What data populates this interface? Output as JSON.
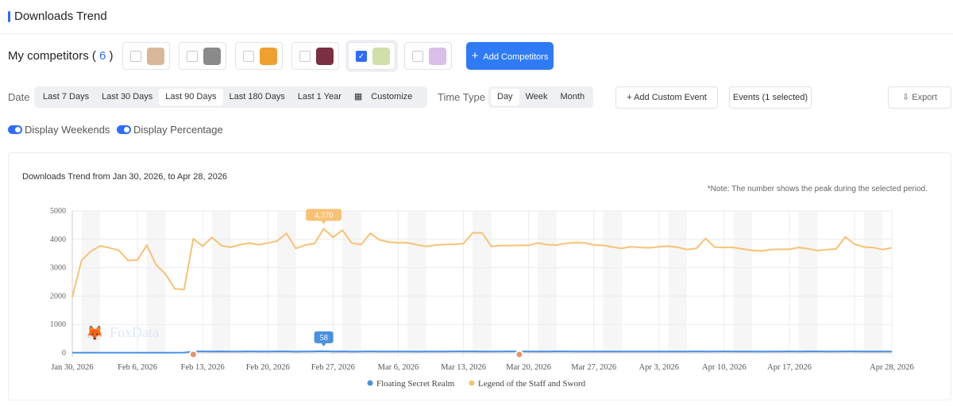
{
  "header": {
    "title": "Downloads Trend"
  },
  "competitors": {
    "label": "My competitors (",
    "count": "6",
    "close": ")",
    "items": [
      {
        "checked": false,
        "color": "#d9b89a"
      },
      {
        "checked": false,
        "color": "#8a8a8a"
      },
      {
        "checked": false,
        "color": "#f0a030"
      },
      {
        "checked": false,
        "color": "#7a3040"
      },
      {
        "checked": true,
        "color": "#cfe0a8"
      },
      {
        "checked": false,
        "color": "#d8c0e8"
      }
    ],
    "add_label": "Add Competitors"
  },
  "date": {
    "label": "Date",
    "options": [
      "Last 7 Days",
      "Last 30 Days",
      "Last 90 Days",
      "Last 180 Days",
      "Last 1 Year",
      "Customize"
    ],
    "selected": "Last 90 Days"
  },
  "time_type": {
    "label": "Time Type",
    "options": [
      "Day",
      "Week",
      "Month"
    ],
    "selected": "Day"
  },
  "buttons": {
    "add_event": "Add Custom Event",
    "events": "Events (1 selected)",
    "export": "Export"
  },
  "toggles": {
    "weekends": "Display Weekends",
    "percentage": "Display Percentage",
    "weekends_on": true,
    "percentage_on": true
  },
  "chart_title": "Downloads Trend from Jan 30, 2026, to Apr 28, 2026",
  "note": "*Note: The number shows the peak during the selected period.",
  "watermark": "FoxData",
  "chart_data": {
    "type": "line",
    "x_start": "2026-01-30",
    "x_end": "2026-04-28",
    "interval": "day",
    "ylim": [
      0,
      5000
    ],
    "yticks": [
      0,
      1000,
      2000,
      3000,
      4000,
      5000
    ],
    "xtick_labels": [
      "Jan 30, 2026",
      "Feb 6, 2026",
      "Feb 13, 2026",
      "Feb 20, 2026",
      "Feb 27, 2026",
      "Mar 6, 2026",
      "Mar 13, 2026",
      "Mar 20, 2026",
      "Mar 27, 2026",
      "Apr 3, 2026",
      "Apr 10, 2026",
      "Apr 17, 2026",
      "",
      "Apr 28, 2026"
    ],
    "weekend_shading": true,
    "grid": true,
    "legend": "bottom",
    "event_dates": [
      "2026-02-12",
      "2026-03-19"
    ],
    "series": [
      {
        "name": "Floating Secret Realm",
        "color": "#4a90e2",
        "peak_label": "58",
        "peak_date": "2026-02-26",
        "values": [
          8,
          8,
          8,
          8,
          8,
          8,
          8,
          8,
          8,
          8,
          8,
          8,
          10,
          48,
          52,
          50,
          54,
          48,
          50,
          52,
          50,
          48,
          52,
          54,
          46,
          50,
          52,
          58,
          50,
          54,
          46,
          50,
          52,
          50,
          48,
          50,
          48,
          46,
          48,
          50,
          50,
          52,
          54,
          52,
          50,
          48,
          50,
          52,
          52,
          48,
          50,
          50,
          52,
          52,
          50,
          48,
          48,
          50,
          48,
          50,
          50,
          48,
          50,
          50,
          50,
          48,
          48,
          52,
          50,
          50,
          52,
          50,
          50,
          48,
          46,
          50,
          50,
          52,
          50,
          54,
          52,
          50,
          50,
          54,
          52,
          50,
          50,
          48,
          50
        ]
      },
      {
        "name": "Legend of the Staff and Sword",
        "color": "#f7c274",
        "peak_label": "4,370",
        "peak_date": "2026-02-26",
        "values": [
          1960,
          3260,
          3580,
          3770,
          3700,
          3610,
          3250,
          3270,
          3790,
          3100,
          2780,
          2260,
          2230,
          4020,
          3760,
          4070,
          3780,
          3720,
          3810,
          3870,
          3810,
          3870,
          3940,
          4210,
          3680,
          3800,
          3850,
          4370,
          4070,
          4320,
          3870,
          3810,
          4210,
          3980,
          3900,
          3880,
          3880,
          3810,
          3750,
          3800,
          3820,
          3820,
          3850,
          4230,
          4230,
          3750,
          3780,
          3780,
          3790,
          3790,
          3870,
          3810,
          3800,
          3860,
          3880,
          3880,
          3800,
          3790,
          3730,
          3680,
          3740,
          3710,
          3700,
          3740,
          3760,
          3720,
          3640,
          3680,
          4030,
          3720,
          3710,
          3710,
          3660,
          3610,
          3590,
          3640,
          3650,
          3650,
          3710,
          3670,
          3600,
          3640,
          3660,
          4080,
          3830,
          3730,
          3710,
          3640,
          3700
        ]
      }
    ]
  }
}
